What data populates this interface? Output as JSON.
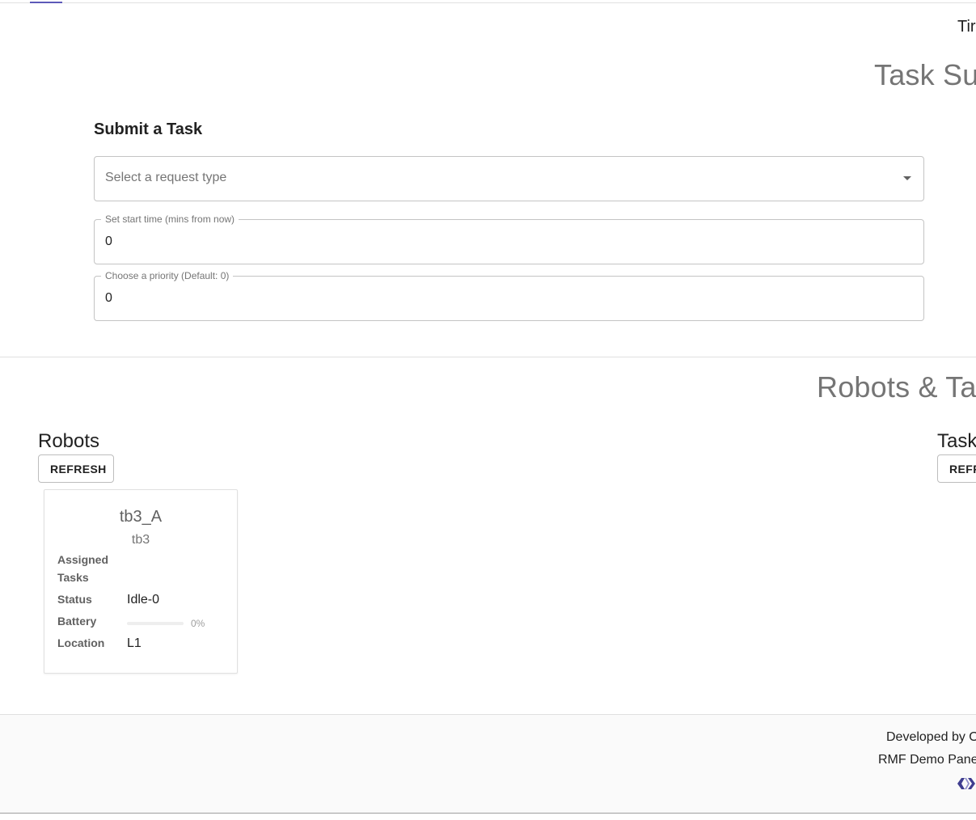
{
  "header": {
    "time_label": "Tir"
  },
  "task_submission": {
    "section_heading": "Task Sub",
    "form_title": "Submit a Task",
    "request_type": {
      "placeholder": "Select a request type"
    },
    "start_time": {
      "label": "Set start time (mins from now)",
      "value": "0"
    },
    "priority": {
      "label": "Choose a priority (Default: 0)",
      "value": "0"
    }
  },
  "robots_tasks": {
    "section_heading": "Robots & Tas",
    "robots": {
      "title": "Robots",
      "refresh_label": "REFRESH",
      "cards": [
        {
          "name": "tb3_A",
          "model": "tb3",
          "assigned_tasks_label": "Assigned Tasks",
          "assigned_tasks_value": "",
          "status_label": "Status",
          "status_value": "Idle-0",
          "battery_label": "Battery",
          "battery_percent": 0,
          "battery_text": "0%",
          "location_label": "Location",
          "location_value": "L1"
        }
      ]
    },
    "tasks": {
      "title": "Task",
      "refresh_label": "REFR"
    }
  },
  "footer": {
    "developed_by": "Developed by O",
    "panel_name": "RMF Demo Pane",
    "logo_icon": "open-robotics-logo-icon"
  },
  "colors": {
    "accent": "#5c59b8",
    "heading_gray": "#757575",
    "footer_bg": "#fafafa"
  }
}
